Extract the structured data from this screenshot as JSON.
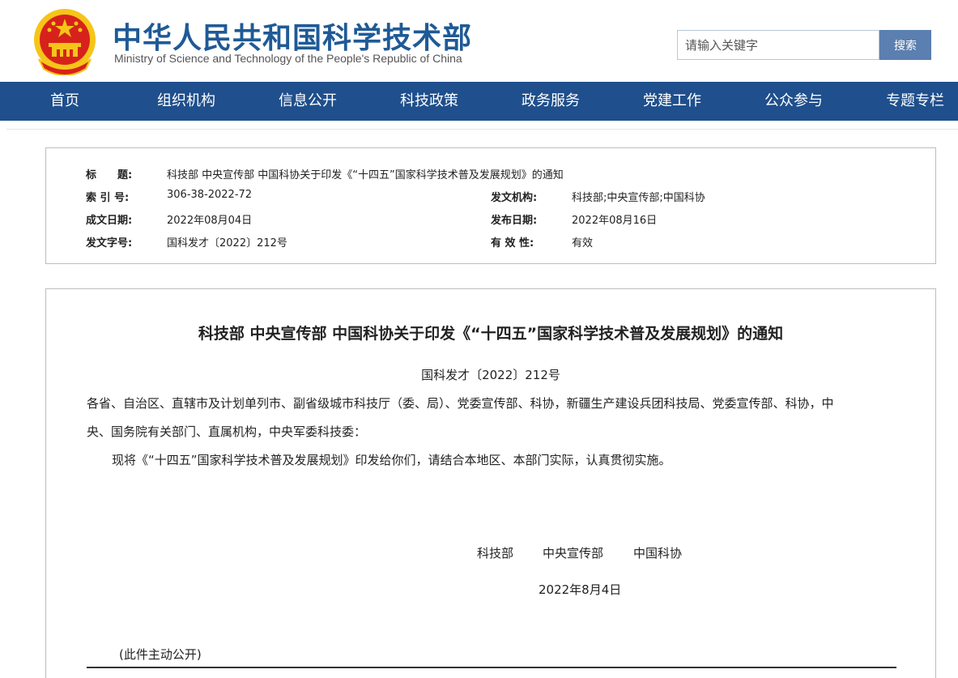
{
  "header": {
    "title": "中华人民共和国科学技术部",
    "subtitle": "Ministry of Science and Technology of the People's Republic of China",
    "search_placeholder": "请输入关键字",
    "search_button": "搜索"
  },
  "nav": {
    "items": [
      "首页",
      "组织机构",
      "信息公开",
      "科技政策",
      "政务服务",
      "党建工作",
      "公众参与",
      "专题专栏"
    ]
  },
  "meta": {
    "title_label": "标　　题:",
    "title_value": "科技部 中央宣传部 中国科协关于印发《“十四五”国家科学技术普及发展规划》的通知",
    "index_label": "索 引 号:",
    "index_value": "306-38-2022-72",
    "issuer_label": "发文机构:",
    "issuer_value": "科技部;中央宣传部;中国科协",
    "date_label": "成文日期:",
    "date_value": "2022年08月04日",
    "publish_label": "发布日期:",
    "publish_value": "2022年08月16日",
    "docnum_label": "发文字号:",
    "docnum_value": "国科发才〔2022〕212号",
    "validity_label": "有 效 性:",
    "validity_value": "有效"
  },
  "article": {
    "title": "科技部 中央宣传部 中国科协关于印发《“十四五”国家科学技术普及发展规划》的通知",
    "doc_number": "国科发才〔2022〕212号",
    "recipients_line1": "各省、自治区、直辖市及计划单列市、副省级城市科技厅（委、局）、党委宣传部、科协，新疆生产建设兵团科技局、党委宣传部、科协，中",
    "recipients_line2": "央、国务院有关部门、直属机构，中央军委科技委：",
    "body": "现将《“十四五”国家科学技术普及发展规划》印发给你们，请结合本地区、本部门实际，认真贯彻实施。",
    "signer_1": "科技部",
    "signer_2": "中央宣传部",
    "signer_3": "中国科协",
    "sign_date": "2022年8月4日",
    "note": "(此件主动公开)"
  },
  "colors": {
    "nav_bg": "#1f4f8c",
    "title_blue": "#1f5a96",
    "search_button_bg": "#5b7fb0",
    "emblem_red": "#d7221c",
    "emblem_gold": "#f5c518"
  }
}
